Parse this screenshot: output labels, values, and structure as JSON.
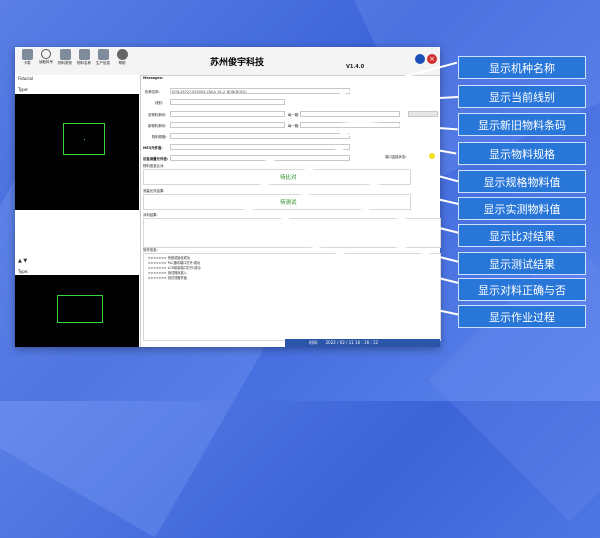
{
  "app": {
    "title": "苏州俊宇科技",
    "version": "V1.4.0",
    "toolbar": [
      "卡零",
      "读取料号",
      "物料类别",
      "物料名称",
      "生产信息",
      "帮助"
    ],
    "close_glyph": "×"
  },
  "left_panel": {
    "top_label": "Fiducial",
    "top_sublabel": "Type:",
    "splitter": "▲ ▼",
    "bottom_label": "Type:"
  },
  "form": {
    "section_label": "Messages:",
    "model_label": "机种名称:",
    "model_value": "ECN-29727-EZ0005-CNLA_V1.2_BON(DOE2)",
    "line_label": "线别:",
    "old_code_label": "旧物料条码:",
    "new_code_label": "新物料条码:",
    "spec_label": "物料规格:",
    "count_label_1": "每一箱:",
    "count_label_2": "每一箱:",
    "spec_value_label": "MES元件值:",
    "measured_label": "设备测量元件值:",
    "compare_label": "物料信息比对:",
    "compare_status": "待比对",
    "test_label": "测量元件结果:",
    "test_status": "待测试",
    "result_label": "对料结果:",
    "device_label": "端口连接状态:",
    "log_label": "操作信息:",
    "log_lines": [
      ">>>>>>> 系统初始化成功",
      ">>>>>>> PLC通讯端口打开:成功",
      ">>>>>>> LCR测量端口打开:成功",
      ">>>>>>> 测试程序载入",
      ">>>>>>> 测试流程开始"
    ]
  },
  "statusbar": {
    "label": "时间:",
    "datetime": "2022 / 02 / 11  16 : 16 : 12"
  },
  "callouts": [
    "显示机种名称",
    "显示当前线别",
    "显示新旧物料条码",
    "显示物料规格",
    "显示规格物料值",
    "显示实测物料值",
    "显示比对结果",
    "显示测试结果",
    "显示对料正确与否",
    "显示作业过程"
  ],
  "colors": {
    "accent": "#2876d8",
    "ok_text": "#1d8a1d",
    "roi": "#3bd43b",
    "indicator": "#f2e21a"
  }
}
